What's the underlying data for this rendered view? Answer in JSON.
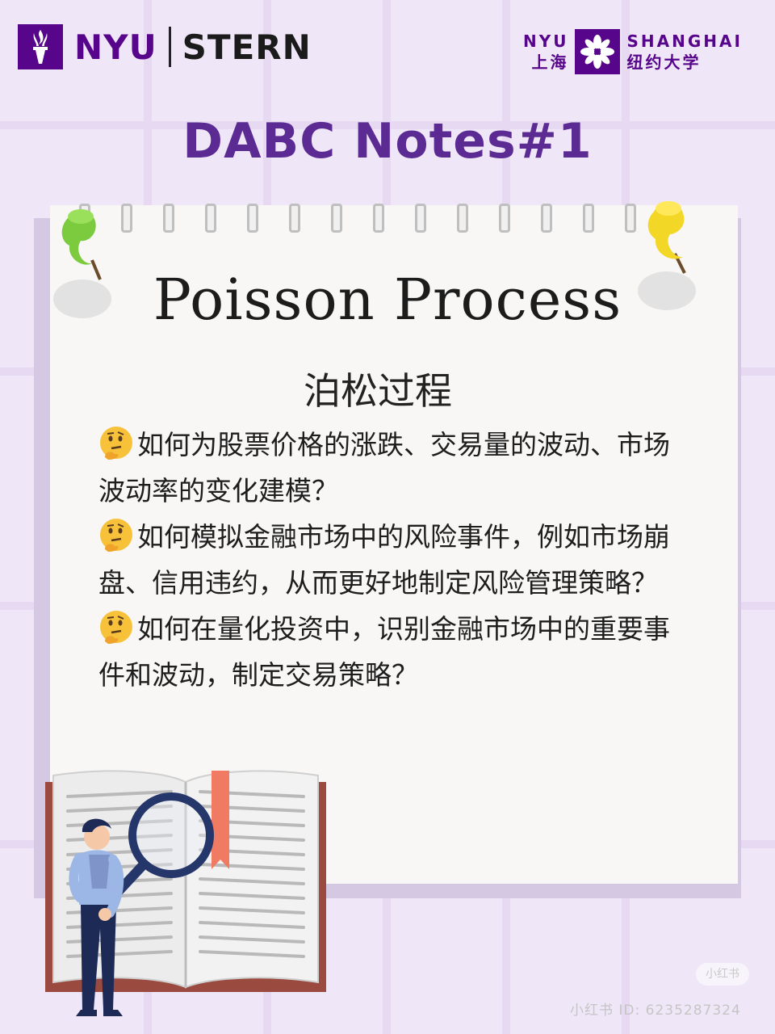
{
  "header": {
    "stern_logo": {
      "nyu": "NYU",
      "stern": "STERN",
      "icon": "torch-icon"
    },
    "shanghai_logo": {
      "left_top": "NYU",
      "left_bottom": "上海",
      "right_top": "SHANGHAI",
      "right_bottom": "纽约大学",
      "icon": "flower-icon"
    }
  },
  "heading": "DABC Notes#1",
  "note": {
    "title_en": "Poisson Process",
    "title_zh": "泊松过程",
    "questions": [
      "如何为股票价格的涨跌、交易量的波动、市场波动率的变化建模？",
      "如何模拟金融市场中的风险事件，例如市场崩盘、信用违约，从而更好地制定风险管理策略？",
      "如何在量化投资中，识别金融市场中的重要事件和波动，制定交易策略？"
    ],
    "question_icon": "thinking-face-icon"
  },
  "watermark": {
    "badge": "小红书",
    "id_text": "小红书 ID: 6235287324"
  },
  "colors": {
    "brand_purple": "#57068c",
    "heading_purple": "#5b2a93",
    "background": "#efe6f7",
    "paper": "#f8f7f6"
  }
}
